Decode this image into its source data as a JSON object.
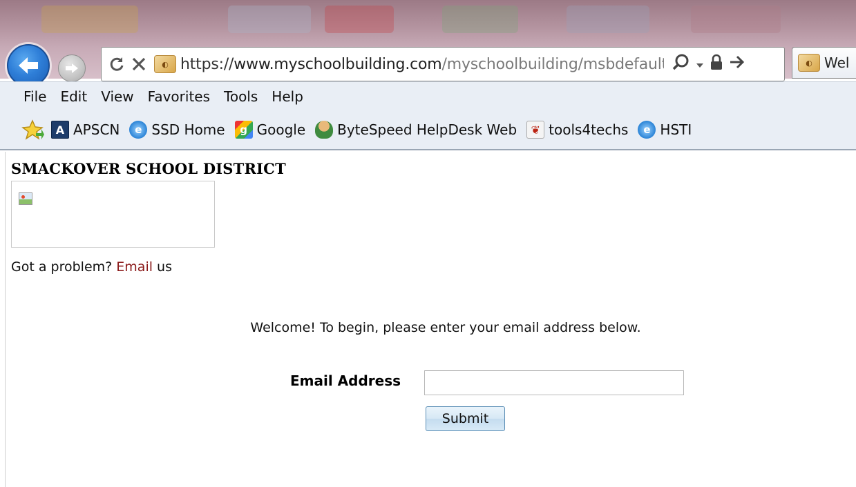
{
  "browser": {
    "address_bar": {
      "url_protocol": "https://",
      "url_host": "www.myschoolbuilding.com",
      "url_path": "/myschoolbuilding/msbdefault"
    },
    "tab": {
      "title": "Wel"
    },
    "menu": [
      "File",
      "Edit",
      "View",
      "Favorites",
      "Tools",
      "Help"
    ],
    "favorites": [
      {
        "label": "APSCN",
        "icon": "apscn-icon"
      },
      {
        "label": "SSD Home",
        "icon": "ie-page-icon"
      },
      {
        "label": "Google",
        "icon": "google-icon"
      },
      {
        "label": "ByteSpeed HelpDesk Web",
        "icon": "person-icon"
      },
      {
        "label": "tools4techs",
        "icon": "plant-icon"
      },
      {
        "label": "HSTI",
        "icon": "ie-page-icon"
      }
    ]
  },
  "page": {
    "district_name": "SMACKOVER SCHOOL DISTRICT",
    "problem_text": "Got a problem?",
    "problem_link": "Email",
    "problem_suffix": "us",
    "welcome_text": "Welcome! To begin, please enter your email address below.",
    "email_label": "Email Address",
    "email_value": "",
    "submit_label": "Submit"
  }
}
